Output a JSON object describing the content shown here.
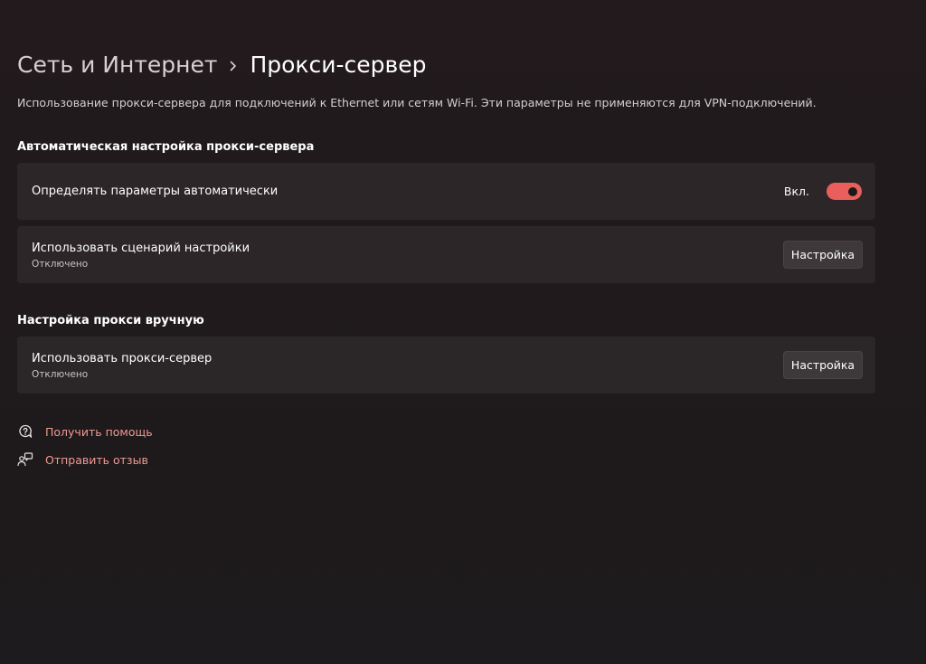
{
  "breadcrumb": {
    "parent": "Сеть и Интернет",
    "current": "Прокси-сервер"
  },
  "description": "Использование прокси-сервера для подключений к Ethernet или сетям Wi-Fi. Эти параметры не применяются для VPN-подключений.",
  "auto_section": {
    "title": "Автоматическая настройка прокси-сервера",
    "detect": {
      "title": "Определять параметры автоматически",
      "toggle_label": "Вкл.",
      "toggle_on": true
    },
    "script": {
      "title": "Использовать сценарий настройки",
      "status": "Отключено",
      "button_label": "Настройка"
    }
  },
  "manual_section": {
    "title": "Настройка прокси вручную",
    "proxy": {
      "title": "Использовать прокси-сервер",
      "status": "Отключено",
      "button_label": "Настройка"
    }
  },
  "links": {
    "help": {
      "label": "Получить помощь",
      "icon": "help-chat-icon"
    },
    "feedback": {
      "label": "Отправить отзыв",
      "icon": "feedback-person-icon"
    }
  },
  "colors": {
    "accent": "#ea5f5b",
    "link": "#ef9a92"
  }
}
